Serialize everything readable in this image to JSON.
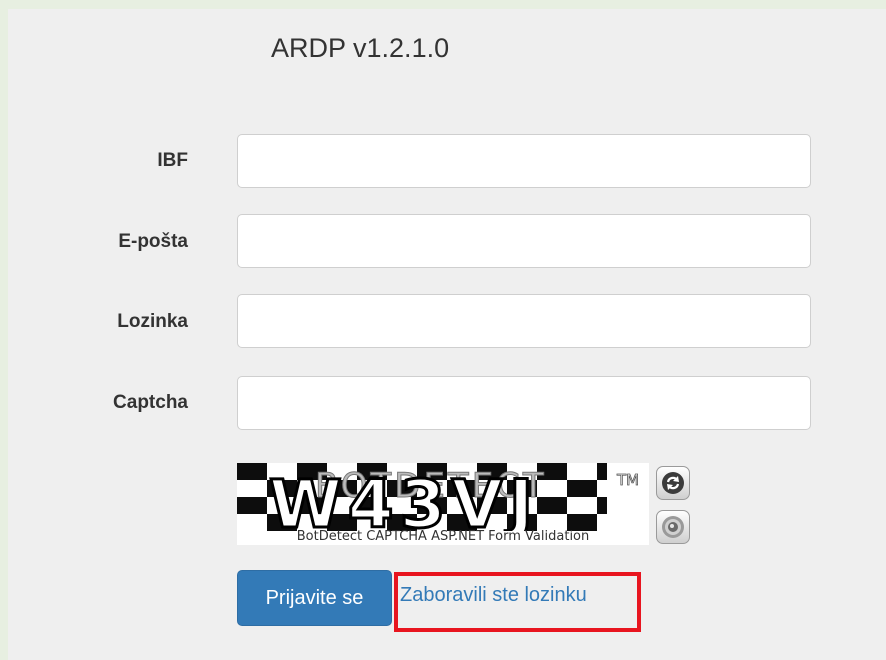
{
  "app": {
    "title": "ARDP v1.2.1.0"
  },
  "form": {
    "fields": [
      {
        "label": "IBF",
        "value": "",
        "placeholder": ""
      },
      {
        "label": "E-pošta",
        "value": "",
        "placeholder": ""
      },
      {
        "label": "Lozinka",
        "value": "",
        "placeholder": ""
      },
      {
        "label": "Captcha",
        "value": "",
        "placeholder": ""
      }
    ],
    "captcha": {
      "code_text": "W43VJ",
      "watermark": "BOTDETECT",
      "trademark": "TM",
      "caption": "BotDetect CAPTCHA ASP.NET Form Validation",
      "reload_icon": "reload-icon",
      "sound_icon": "speaker-icon"
    },
    "login_label": "Prijavite se",
    "forgot_label": "Zaboravili ste lozinku"
  },
  "colors": {
    "page_bg": "#e7efe1",
    "panel_bg": "#efefef",
    "primary": "#337ab7",
    "highlight": "#e8151f"
  }
}
